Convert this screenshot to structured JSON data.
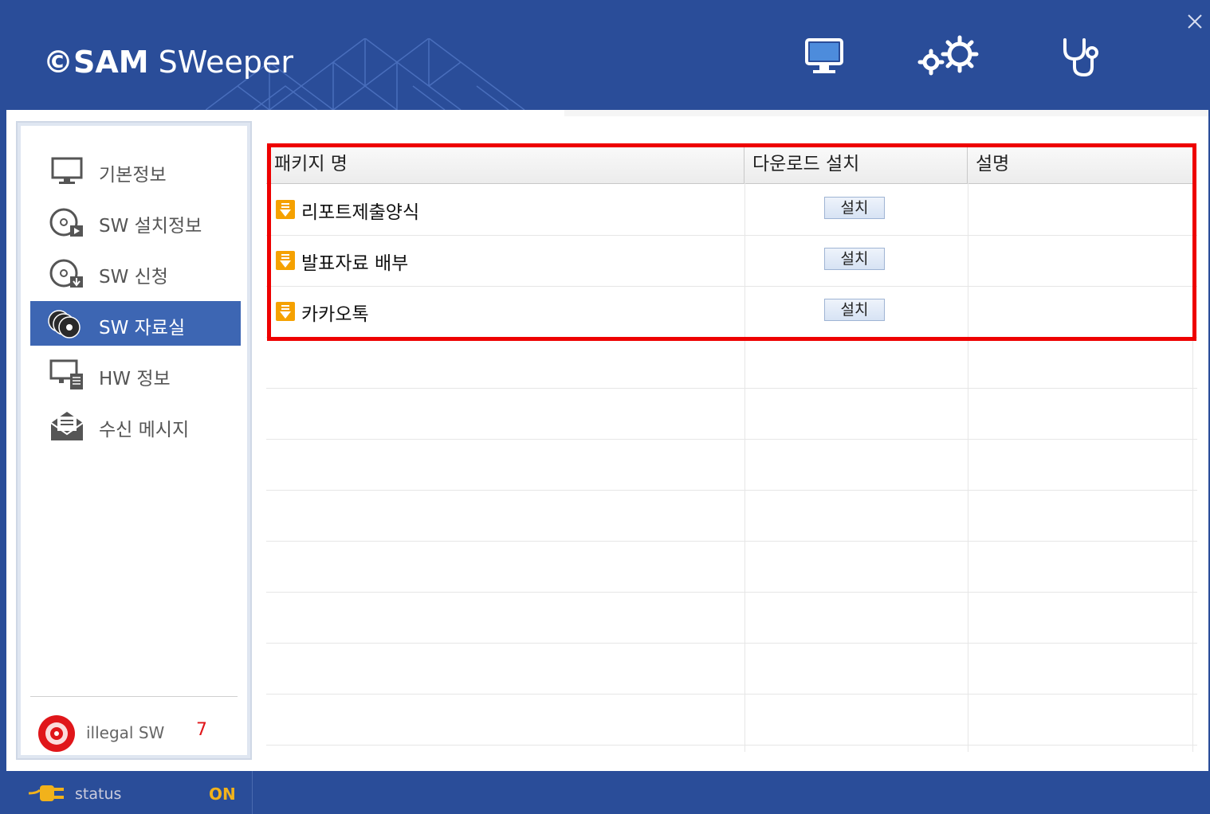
{
  "app": {
    "logo_prefix": "©SAM",
    "logo_suffix": " SWeeper"
  },
  "header": {
    "icons": [
      "monitor-icon",
      "gears-icon",
      "stethoscope-icon",
      "close-icon"
    ]
  },
  "sidebar": {
    "items": [
      {
        "label": "기본정보",
        "icon": "monitor-icon",
        "active": false
      },
      {
        "label": "SW 설치정보",
        "icon": "disc-play-icon",
        "active": false
      },
      {
        "label": "SW 신청",
        "icon": "disc-download-icon",
        "active": false
      },
      {
        "label": "SW 자료실",
        "icon": "discs-stack-icon",
        "active": true
      },
      {
        "label": "HW 정보",
        "icon": "hardware-icon",
        "active": false
      },
      {
        "label": "수신 메시지",
        "icon": "envelope-icon",
        "active": false
      }
    ],
    "illegal": {
      "label": "illegal  SW",
      "count": "7"
    }
  },
  "grid": {
    "columns": [
      "패키지 명",
      "다운로드 설치",
      "설명"
    ],
    "rows": [
      {
        "name": "리포트제출양식",
        "button": "설치",
        "description": ""
      },
      {
        "name": "발표자료 배부",
        "button": "설치",
        "description": ""
      },
      {
        "name": "카카오톡",
        "button": "설치",
        "description": ""
      }
    ]
  },
  "status": {
    "label": "status",
    "value": "ON"
  },
  "colors": {
    "brand": "#2a4d99",
    "active_nav": "#3d66b3",
    "highlight": "#ee0000",
    "status_on": "#f2b21b",
    "illegal_count": "#e0161a"
  }
}
